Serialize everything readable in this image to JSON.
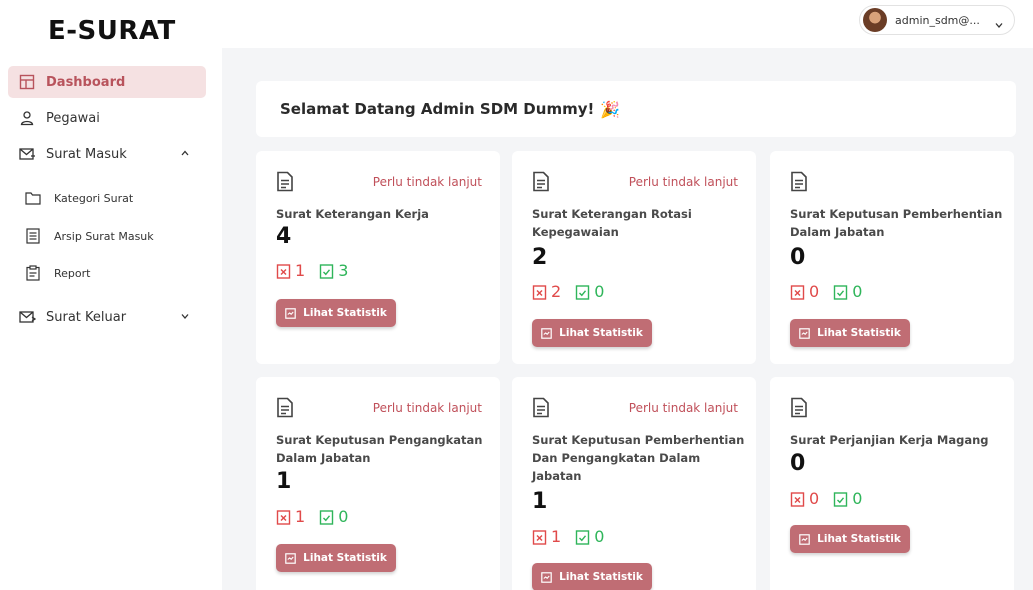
{
  "app": {
    "brand": "E-SURAT"
  },
  "user": {
    "name": "admin_sdm@..."
  },
  "sidebar": {
    "items": [
      {
        "label": "Dashboard"
      },
      {
        "label": "Pegawai"
      },
      {
        "label": "Surat Masuk"
      },
      {
        "label": "Surat Keluar"
      }
    ],
    "sub_items": [
      {
        "label": "Kategori Surat"
      },
      {
        "label": "Arsip Surat Masuk"
      },
      {
        "label": "Report"
      }
    ]
  },
  "welcome": {
    "text": "Selamat Datang Admin SDM Dummy!",
    "emoji": "🎉"
  },
  "button_label": "Lihat Statistik",
  "flag_label": "Perlu tindak lanjut",
  "cards": [
    {
      "title": "Surat Keterangan Kerja",
      "count": "4",
      "rejected": "1",
      "approved": "3",
      "needs_action": true
    },
    {
      "title": "Surat Keterangan Rotasi Kepegawaian",
      "count": "2",
      "rejected": "2",
      "approved": "0",
      "needs_action": true
    },
    {
      "title": "Surat Keputusan Pemberhentian Dalam Jabatan",
      "count": "0",
      "rejected": "0",
      "approved": "0",
      "needs_action": false
    },
    {
      "title": "Surat Keputusan Pengangkatan Dalam Jabatan",
      "count": "1",
      "rejected": "1",
      "approved": "0",
      "needs_action": true
    },
    {
      "title": "Surat Keputusan Pemberhentian Dan Pengangkatan Dalam Jabatan",
      "count": "1",
      "rejected": "1",
      "approved": "0",
      "needs_action": true
    },
    {
      "title": "Surat Perjanjian Kerja Magang",
      "count": "0",
      "rejected": "0",
      "approved": "0",
      "needs_action": false
    }
  ],
  "colors": {
    "accent": "#c06d74",
    "active_bg": "#f5e1e2",
    "rejected": "#e04a4a",
    "approved": "#2fb55a",
    "flag": "#c0505a"
  }
}
